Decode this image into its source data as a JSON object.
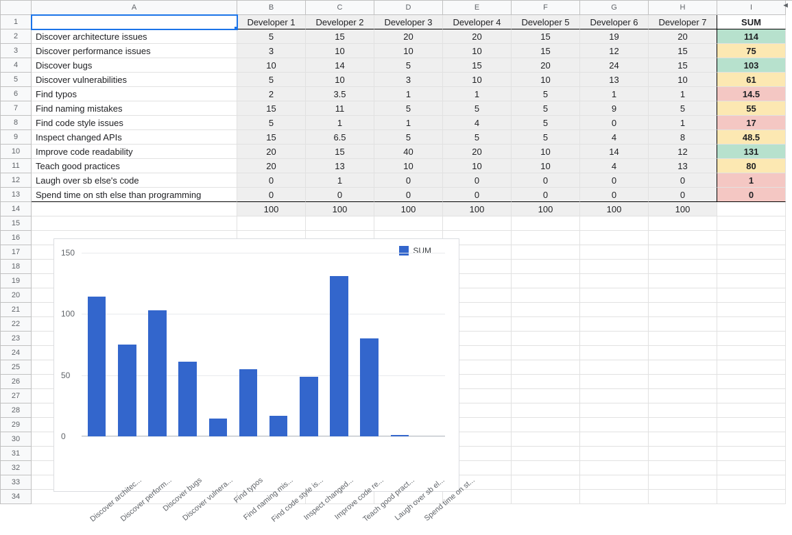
{
  "columns": [
    "A",
    "B",
    "C",
    "D",
    "E",
    "F",
    "G",
    "H",
    "I"
  ],
  "row_count": 34,
  "header": [
    "",
    "Developer 1",
    "Developer 2",
    "Developer 3",
    "Developer 4",
    "Developer 5",
    "Developer 6",
    "Developer 7",
    "SUM"
  ],
  "rows": [
    {
      "label": "Discover architecture issues",
      "vals": [
        5,
        15,
        20,
        20,
        15,
        19,
        20
      ],
      "sum": 114,
      "sum_color": "green"
    },
    {
      "label": "Discover performance issues",
      "vals": [
        3,
        10,
        10,
        10,
        15,
        12,
        15
      ],
      "sum": 75,
      "sum_color": "yellow"
    },
    {
      "label": "Discover bugs",
      "vals": [
        10,
        14,
        5,
        15,
        20,
        24,
        15
      ],
      "sum": 103,
      "sum_color": "green"
    },
    {
      "label": "Discover vulnerabilities",
      "vals": [
        5,
        10,
        3,
        10,
        10,
        13,
        10
      ],
      "sum": 61,
      "sum_color": "yellow"
    },
    {
      "label": "Find typos",
      "vals": [
        2,
        3.5,
        1,
        1,
        5,
        1,
        1
      ],
      "sum": 14.5,
      "sum_color": "red"
    },
    {
      "label": "Find naming mistakes",
      "vals": [
        15,
        11,
        5,
        5,
        5,
        9,
        5
      ],
      "sum": 55,
      "sum_color": "yellow"
    },
    {
      "label": "Find code style issues",
      "vals": [
        5,
        1,
        1,
        4,
        5,
        0,
        1
      ],
      "sum": 17,
      "sum_color": "red"
    },
    {
      "label": "Inspect changed APIs",
      "vals": [
        15,
        6.5,
        5,
        5,
        5,
        4,
        8
      ],
      "sum": 48.5,
      "sum_color": "yellow"
    },
    {
      "label": "Improve code readability",
      "vals": [
        20,
        15,
        40,
        20,
        10,
        14,
        12
      ],
      "sum": 131,
      "sum_color": "green"
    },
    {
      "label": "Teach good practices",
      "vals": [
        20,
        13,
        10,
        10,
        10,
        4,
        13
      ],
      "sum": 80,
      "sum_color": "yellow"
    },
    {
      "label": "Laugh over sb else's code",
      "vals": [
        0,
        1,
        0,
        0,
        0,
        0,
        0
      ],
      "sum": 1,
      "sum_color": "red"
    },
    {
      "label": "Spend time on sth else than programming",
      "vals": [
        0,
        0,
        0,
        0,
        0,
        0,
        0
      ],
      "sum": 0,
      "sum_color": "red"
    }
  ],
  "totals": [
    "",
    100,
    100,
    100,
    100,
    100,
    100,
    100,
    ""
  ],
  "chart_data": {
    "type": "bar",
    "legend": "SUM",
    "ylim": [
      0,
      150
    ],
    "yticks": [
      0,
      50,
      100,
      150
    ],
    "series": [
      {
        "name": "SUM",
        "values": [
          114,
          75,
          103,
          61,
          14.5,
          55,
          17,
          48.5,
          131,
          80,
          1,
          0
        ]
      }
    ],
    "categories": [
      "Discover architec...",
      "Discover perform...",
      "Discover bugs",
      "Discover vulnera...",
      "Find typos",
      "Find naming mis...",
      "Find code style is...",
      "Inspect changed...",
      "Improve code re...",
      "Teach good pract...",
      "Laugh over sb el...",
      "Spend time on st..."
    ]
  },
  "scroll_indicator": "◄"
}
